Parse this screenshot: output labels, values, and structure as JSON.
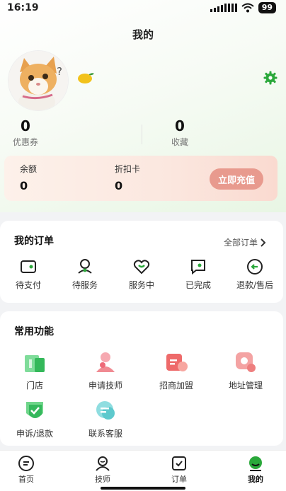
{
  "status_bar": {
    "time": "16:19",
    "battery": "99"
  },
  "header": {
    "title": "我的"
  },
  "profile": {
    "help_mark": "?"
  },
  "stats": [
    {
      "value": "0",
      "label": "优惠券"
    },
    {
      "value": "0",
      "label": "收藏"
    }
  ],
  "balance": {
    "balance_label": "余额",
    "balance_value": "0",
    "discount_label": "折扣卡",
    "discount_value": "0",
    "recharge_label": "立即充值"
  },
  "orders": {
    "title": "我的订单",
    "all_label": "全部订单",
    "items": [
      {
        "label": "待支付",
        "icon": "wallet-icon"
      },
      {
        "label": "待服务",
        "icon": "service-person-icon"
      },
      {
        "label": "服务中",
        "icon": "heart-icon"
      },
      {
        "label": "已完成",
        "icon": "message-check-icon"
      },
      {
        "label": "退款/售后",
        "icon": "refund-icon"
      }
    ]
  },
  "functions": {
    "title": "常用功能",
    "items": [
      {
        "label": "门店",
        "icon": "store-icon"
      },
      {
        "label": "申请技师",
        "icon": "apply-technician-icon"
      },
      {
        "label": "招商加盟",
        "icon": "franchise-icon"
      },
      {
        "label": "地址管理",
        "icon": "location-icon"
      },
      {
        "label": "申诉/退款",
        "icon": "appeal-icon"
      },
      {
        "label": "联系客服",
        "icon": "customer-service-icon"
      }
    ]
  },
  "tabs": [
    {
      "label": "首页",
      "icon": "home-icon"
    },
    {
      "label": "技师",
      "icon": "technician-icon"
    },
    {
      "label": "订单",
      "icon": "order-icon"
    },
    {
      "label": "我的",
      "icon": "profile-icon",
      "active": true
    }
  ],
  "colors": {
    "accent_green": "#2aa83a",
    "recharge_button": "#e89a8e",
    "function_green": "#3cc46a",
    "function_pink": "#f08a92",
    "function_red": "#ee6a6a",
    "function_teal": "#7fd3d6"
  }
}
